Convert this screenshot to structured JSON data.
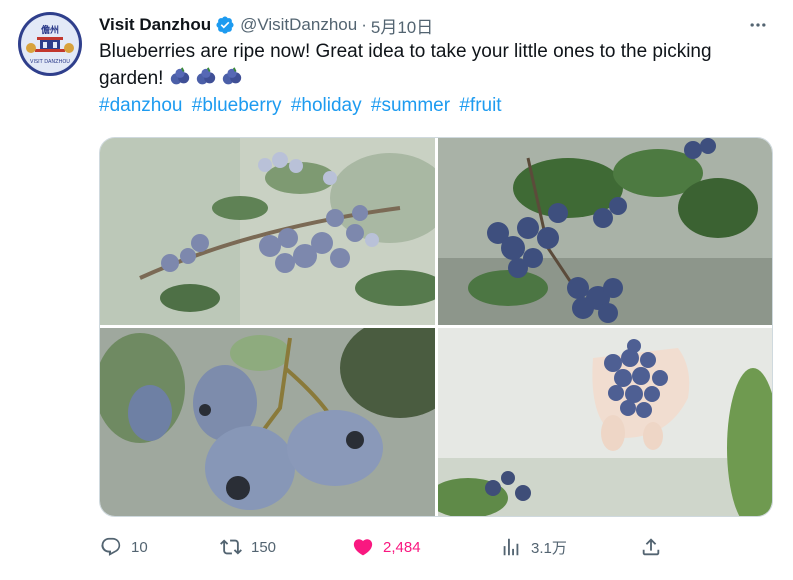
{
  "account": {
    "name": "Visit Danzhou",
    "handle": "@VisitDanzhou",
    "separator": "·",
    "date": "5月10日",
    "avatar_text_top": "儋州",
    "avatar_text_bottom": "VISIT DANZHOU"
  },
  "tweet": {
    "text": "Blueberries are ripe now! Great idea to take your little ones to the picking garden!",
    "emoji": [
      "blueberry-emoji",
      "blueberry-emoji",
      "blueberry-emoji"
    ],
    "hashtags": [
      "#danzhou",
      "#blueberry",
      "#holiday",
      "#summer",
      "#fruit"
    ]
  },
  "media": {
    "photos": [
      "blueberry-branch-photo",
      "blueberry-cluster-photo",
      "blueberry-closeup-photo",
      "blueberries-in-hand-photo"
    ]
  },
  "actions": {
    "replies": "10",
    "reposts": "150",
    "likes": "2,484",
    "views": "3.1万"
  },
  "colors": {
    "accent": "#1d9bf0",
    "like": "#f91880",
    "muted": "#536471",
    "verified": "#1d9bf0"
  }
}
